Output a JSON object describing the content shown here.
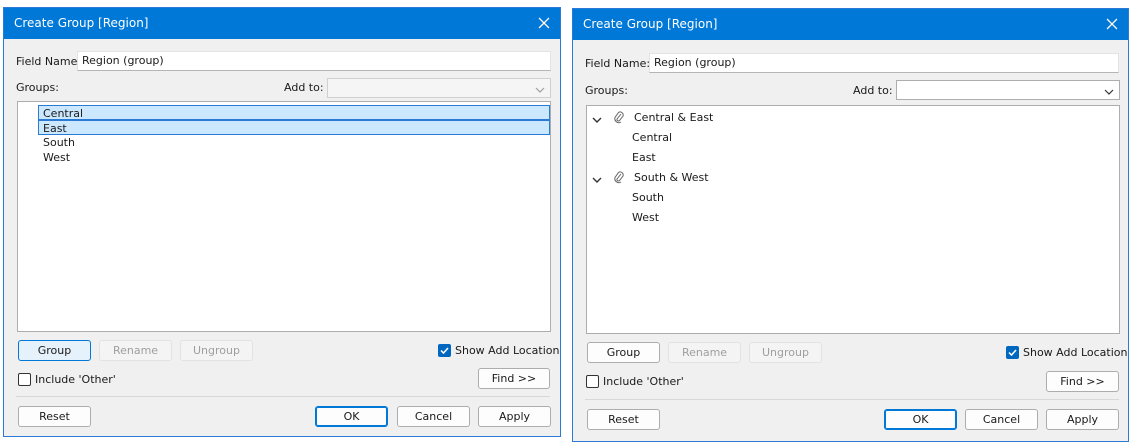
{
  "colors": {
    "titlebar": "#0078d7",
    "selection_fill": "#cce8ff",
    "selection_border": "#2b7bd6",
    "checkbox_checked": "#0067c0"
  },
  "dialogs": [
    {
      "title": "Create Group [Region]",
      "field_name_label": "Field Name:",
      "field_name_value": "Region (group)",
      "groups_label": "Groups:",
      "add_to_label": "Add to:",
      "add_to_value": "",
      "items": [
        {
          "label": "Central",
          "selected": true
        },
        {
          "label": "East",
          "selected": true
        },
        {
          "label": "South",
          "selected": false
        },
        {
          "label": "West",
          "selected": false
        }
      ],
      "buttons": {
        "group": "Group",
        "rename": "Rename",
        "ungroup": "Ungroup",
        "find": "Find >>",
        "reset": "Reset",
        "ok": "OK",
        "cancel": "Cancel",
        "apply": "Apply"
      },
      "show_add_location": {
        "label": "Show Add Location",
        "checked": true
      },
      "include_other": {
        "label": "Include 'Other'",
        "checked": false
      }
    },
    {
      "title": "Create Group [Region]",
      "field_name_label": "Field Name:",
      "field_name_value": "Region (group)",
      "groups_label": "Groups:",
      "add_to_label": "Add to:",
      "add_to_value": "",
      "tree": [
        {
          "label": "Central & East",
          "icon": "paperclip-icon",
          "expanded": true,
          "children": [
            "Central",
            "East"
          ]
        },
        {
          "label": "South & West",
          "icon": "paperclip-icon",
          "expanded": true,
          "children": [
            "South",
            "West"
          ]
        }
      ],
      "buttons": {
        "group": "Group",
        "rename": "Rename",
        "ungroup": "Ungroup",
        "find": "Find >>",
        "reset": "Reset",
        "ok": "OK",
        "cancel": "Cancel",
        "apply": "Apply"
      },
      "show_add_location": {
        "label": "Show Add Location",
        "checked": true
      },
      "include_other": {
        "label": "Include 'Other'",
        "checked": false
      }
    }
  ]
}
